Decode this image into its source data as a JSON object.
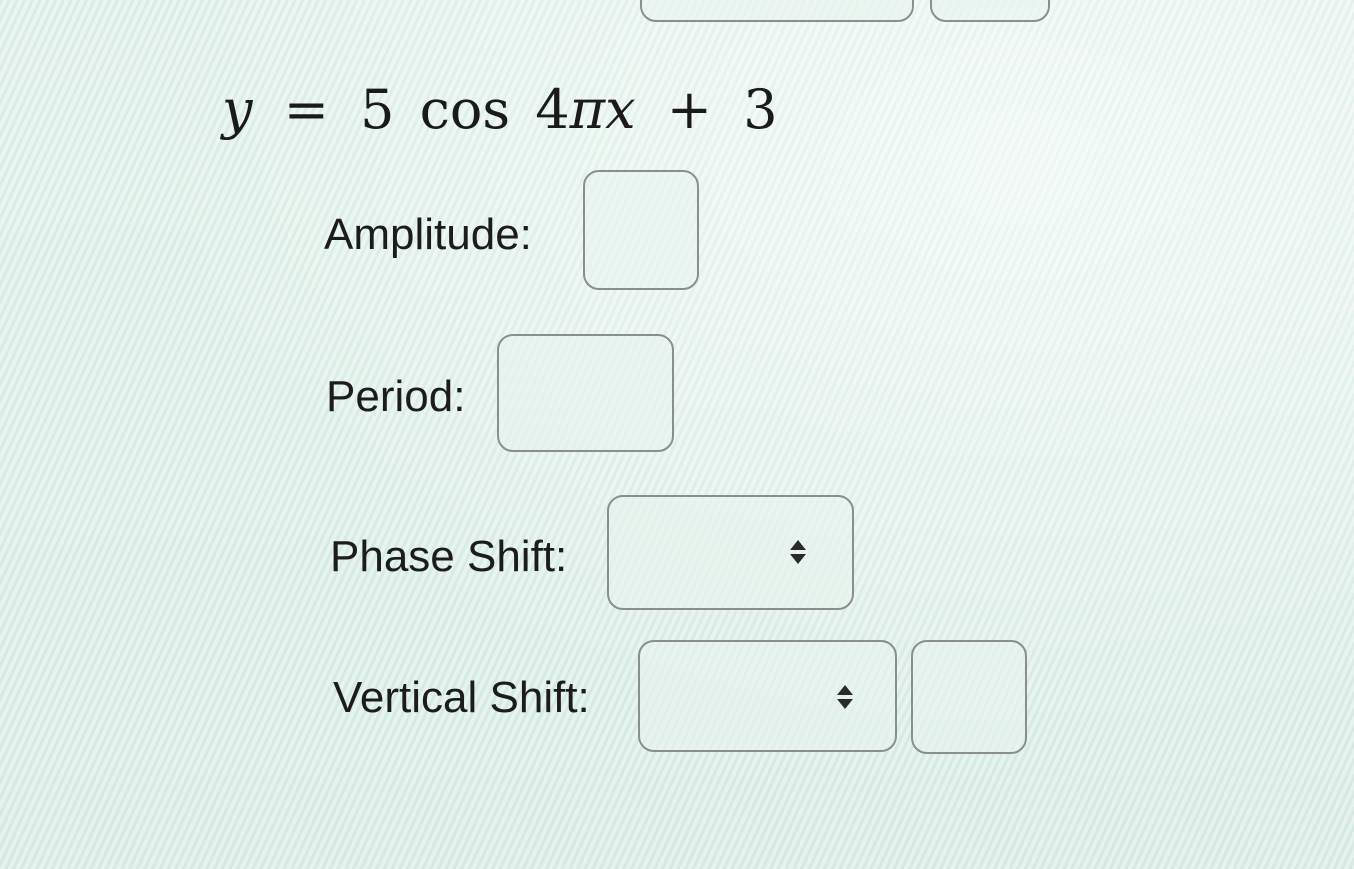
{
  "equation": {
    "y": "y",
    "eq": "=",
    "coef": "5",
    "func": "cos",
    "arg_num": "4",
    "arg_pi": "π",
    "arg_x": "x",
    "plus": "+",
    "const": "3"
  },
  "fields": {
    "amplitude": {
      "label": "Amplitude:",
      "value": ""
    },
    "period": {
      "label": "Period:",
      "value": ""
    },
    "phase_shift": {
      "label": "Phase Shift:",
      "selected": ""
    },
    "vertical_shift": {
      "label": "Vertical Shift:",
      "selected": "",
      "value": ""
    }
  },
  "icons": {
    "select_arrows": "updown-arrows-icon"
  },
  "colors": {
    "background": "#e3f1ec",
    "box_border": "#8a8f8c",
    "text": "#1c1c1c"
  }
}
